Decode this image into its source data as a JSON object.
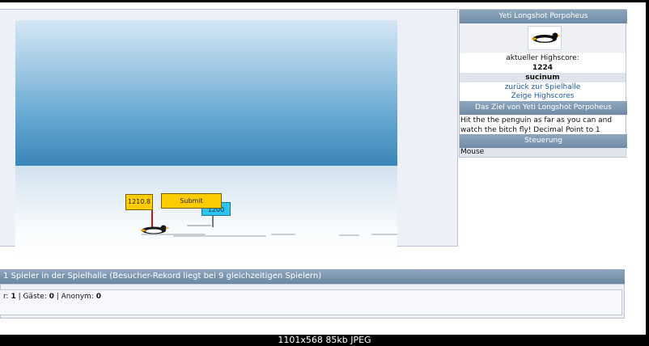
{
  "game": {
    "distance_label": "1210.8",
    "submit_label": "Submit",
    "highscore_marker": "1200"
  },
  "sidebar": {
    "game_title": "Yeti Longshot Porpoheus",
    "highscore_label": "aktueller Highscore:",
    "highscore_value": "1224",
    "highscore_user": "sucinum",
    "back_link": "zurück zur Spielhalle",
    "show_highscores_link": "Zeige Highscores",
    "goal_header": "Das Ziel von Yeti Longshot Porpoheus",
    "goal_text": "Hit the the penguin as far as you can and watch the bitch fly! Decimal Point to 1",
    "controls_header": "Steuerung",
    "controls_value": "Mouse"
  },
  "stats": {
    "header": "1 Spieler in der Spielhalle (Besucher-Rekord liegt bei 9 gleichzeitigen Spielern)",
    "members_prefix": "r: ",
    "members_count": "1",
    "guests_label": " | Gäste: ",
    "guests_count": "0",
    "anon_label": " | Anonym: ",
    "anon_count": "0"
  },
  "image_caption": "1101x568  85kb  JPEG",
  "colors": {
    "header_bg": "#7b93ad",
    "link": "#1b5c9e",
    "sign_yellow": "#ffcc00",
    "sign_cyan": "#2fc3ee"
  },
  "icons": {
    "penguin": "penguin-icon"
  }
}
